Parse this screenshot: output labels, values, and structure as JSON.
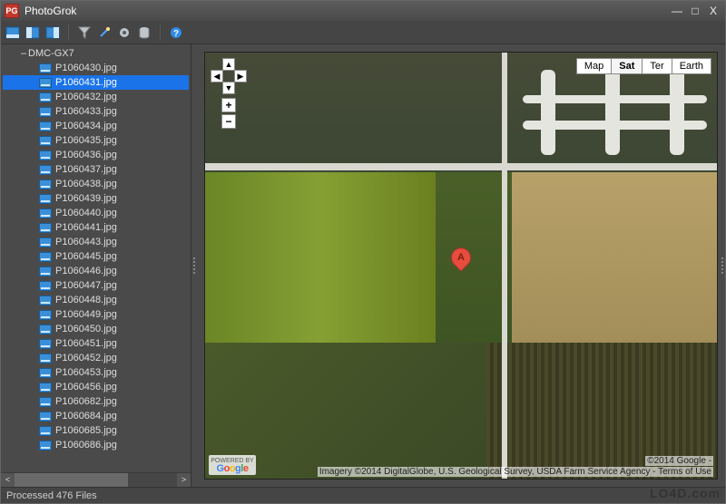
{
  "window": {
    "title": "PhotoGrok",
    "app_icon_text": "PG"
  },
  "window_buttons": {
    "min": "—",
    "max": "□",
    "close": "X"
  },
  "toolbar": {
    "icons": [
      "window1-icon",
      "window2-icon",
      "window3-icon",
      "filter-icon",
      "wand-icon",
      "gear-icon",
      "database-icon",
      "help-icon"
    ]
  },
  "sidebar": {
    "root": {
      "expander": "–",
      "label": "DMC-GX7"
    },
    "files": [
      "P1060430.jpg",
      "P1060431.jpg",
      "P1060432.jpg",
      "P1060433.jpg",
      "P1060434.jpg",
      "P1060435.jpg",
      "P1060436.jpg",
      "P1060437.jpg",
      "P1060438.jpg",
      "P1060439.jpg",
      "P1060440.jpg",
      "P1060441.jpg",
      "P1060443.jpg",
      "P1060445.jpg",
      "P1060446.jpg",
      "P1060447.jpg",
      "P1060448.jpg",
      "P1060449.jpg",
      "P1060450.jpg",
      "P1060451.jpg",
      "P1060452.jpg",
      "P1060453.jpg",
      "P1060456.jpg",
      "P1060682.jpg",
      "P1060684.jpg",
      "P1060685.jpg",
      "P1060686.jpg"
    ],
    "selected_index": 1,
    "scroll": {
      "left": "<",
      "right": ">"
    }
  },
  "map": {
    "types": [
      "Map",
      "Sat",
      "Ter",
      "Earth"
    ],
    "active_type_index": 1,
    "marker_label": "A",
    "pan": {
      "up": "▲",
      "down": "▼",
      "left": "◀",
      "right": "▶"
    },
    "zoom": {
      "in": "+",
      "out": "−"
    },
    "attribution": "Imagery ©2014 DigitalGlobe, U.S. Geological Survey, USDA Farm Service Agency - Terms of Use",
    "copyright": "©2014 Google -",
    "badge_top": "POWERED BY",
    "badge_brand": "Google"
  },
  "status": {
    "text": "Processed 476 Files"
  },
  "watermark": "LO4D.com"
}
